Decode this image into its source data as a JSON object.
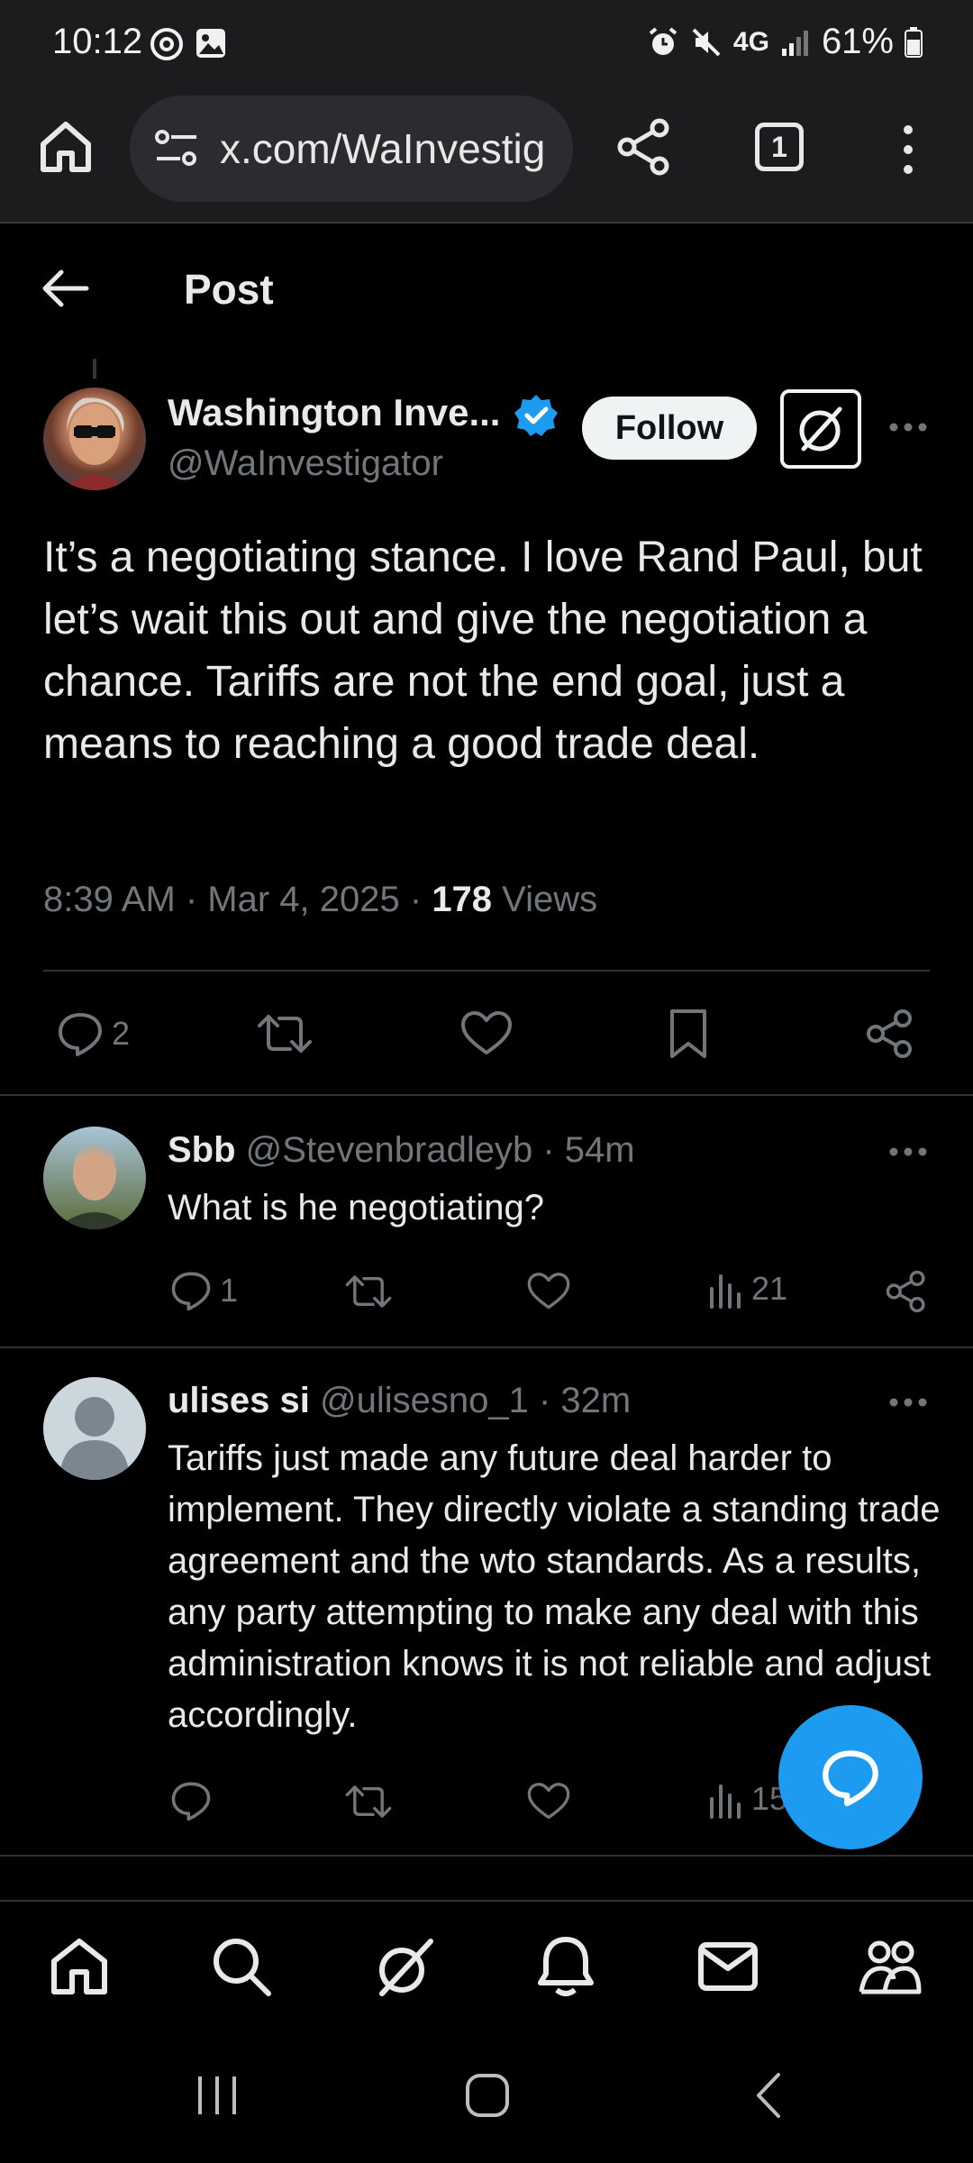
{
  "status_bar": {
    "time": "10:12",
    "network": "4G",
    "battery": "61%"
  },
  "browser": {
    "url": "x.com/WaInvestig",
    "tab_count": "1"
  },
  "header": {
    "title": "Post"
  },
  "tweet": {
    "author_name": "Washington Inve...",
    "author_handle": "@WaInvestigator",
    "follow_label": "Follow",
    "text": "It’s a negotiating stance. I love Rand Paul, but let’s wait this out and give the negotiation a chance. Tariffs are not the end goal, just a means to reaching a good trade deal.",
    "time": "8:39 AM · Mar 4, 2025 · ",
    "views_count": "178",
    "views_label": " Views",
    "reply_count": "2"
  },
  "replies": [
    {
      "name": "Sbb",
      "handle_time": " @Stevenbradleyb · 54m",
      "text": "What is he negotiating?",
      "reply_count": "1",
      "views": "21"
    },
    {
      "name": "ulises si",
      "handle_time": " @ulisesno_1 · 32m",
      "text": "Tariffs just made any future deal harder to implement. They directly violate a standing trade agreement and the wto standards. As a results, any party attempting to make any deal with this administration knows it is not reliable and adjust accordingly.",
      "views": "15"
    }
  ],
  "colors": {
    "accent": "#1d9bf0",
    "muted": "#71767b",
    "text": "#e7e9ea",
    "divider": "#2f3336"
  }
}
